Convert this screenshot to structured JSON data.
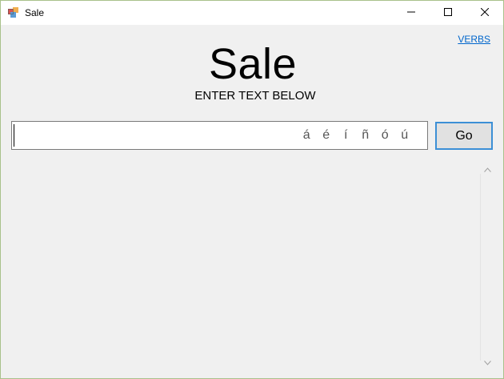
{
  "window": {
    "title": "Sale"
  },
  "header": {
    "verbs_link": "VERBS",
    "title": "Sale",
    "subtitle": "ENTER TEXT BELOW"
  },
  "input": {
    "value": "",
    "accents": [
      "á",
      "é",
      "í",
      "ñ",
      "ó",
      "ú"
    ]
  },
  "go_button": {
    "label": "Go"
  },
  "icons": {
    "app": "app-icon",
    "minimize": "minimize-icon",
    "maximize": "maximize-icon",
    "close": "close-icon",
    "scroll_up": "chevron-up-icon",
    "scroll_down": "chevron-down-icon"
  },
  "colors": {
    "window_bg": "#f0f0f0",
    "link": "#0066cc",
    "focus_border": "#3c8fd6"
  }
}
